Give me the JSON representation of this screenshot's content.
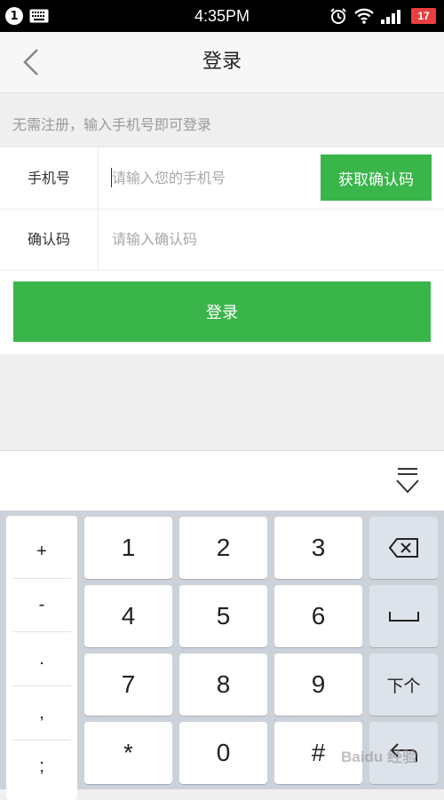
{
  "status_bar": {
    "notification_count": "1",
    "time": "4:35PM",
    "battery_level": "17",
    "icons": [
      "keyboard-icon",
      "alarm-icon",
      "wifi-icon",
      "signal-icon",
      "battery-icon"
    ]
  },
  "header": {
    "title": "登录",
    "back_icon": "chevron-left-icon"
  },
  "hint": "无需注册，输入手机号即可登录",
  "form": {
    "phone_label": "手机号",
    "phone_placeholder": "请输入您的手机号",
    "phone_value": "",
    "get_code_label": "获取确认码",
    "code_label": "确认码",
    "code_placeholder": "请输入确认码",
    "code_value": "",
    "login_label": "登录"
  },
  "keyboard": {
    "hide_icon": "keyboard-hide-icon",
    "symbols": [
      "+",
      "-",
      ".",
      ",",
      ";"
    ],
    "digits": [
      "1",
      "2",
      "3",
      "4",
      "5",
      "6",
      "7",
      "8",
      "9",
      "*",
      "0",
      "#"
    ],
    "next_label": "下个",
    "fn_icons": [
      "backspace-icon",
      "space-icon",
      "enter-icon"
    ]
  },
  "watermark": "Baidu 经验",
  "colors": {
    "accent": "#39b54a",
    "battery": "#e84040"
  }
}
